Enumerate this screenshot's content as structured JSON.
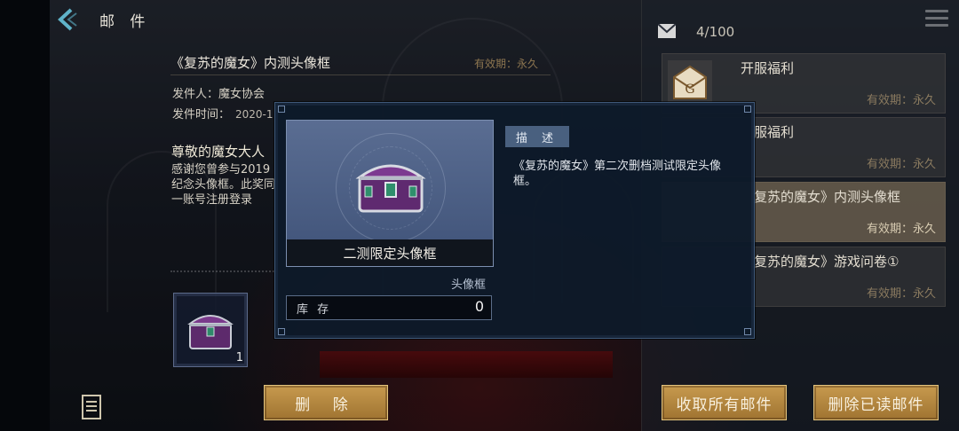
{
  "header": {
    "title": "邮 件"
  },
  "mail_detail": {
    "title": "《复苏的魔女》内测头像框",
    "expire": "有效期：永久",
    "sender_label": "发件人：",
    "sender": "魔女协会",
    "time_label": "发件时间：",
    "time_value": "2020-1",
    "greeting": "尊敬的魔女大人",
    "body": "感谢您曾参与2019纪念头像框。此奖同一账号注册登录",
    "attachment_count": "1"
  },
  "buttons": {
    "delete": "删 除",
    "collect_all": "收取所有邮件",
    "delete_read": "删除已读邮件"
  },
  "mailbox": {
    "count": "4/100",
    "items": [
      {
        "name": "开服福利",
        "expire": "有效期：永久"
      },
      {
        "name": "服福利",
        "expire": "有效期：永久"
      },
      {
        "name": "复苏的魔女》内测头像框",
        "expire": "有效期：永久"
      },
      {
        "name": "复苏的魔女》游戏问卷①",
        "expire": "有效期：永久"
      }
    ]
  },
  "popup": {
    "item_name": "二测限定头像框",
    "item_type": "头像框",
    "stock_label": "库 存",
    "stock_value": "0",
    "desc_tag": "描 述",
    "description": "《复苏的魔女》第二次删档测试限定头像框。"
  },
  "colors": {
    "gold_button": "#b8883f",
    "popup_bg": "#0e1a2a",
    "desc_tag": "#49607f",
    "chest_purple": "#6b2f7a"
  },
  "icons": [
    "back-arrow-icon",
    "menu-icon",
    "envelope-icon",
    "letter-seal-icon",
    "notes-icon",
    "chest-icon"
  ]
}
